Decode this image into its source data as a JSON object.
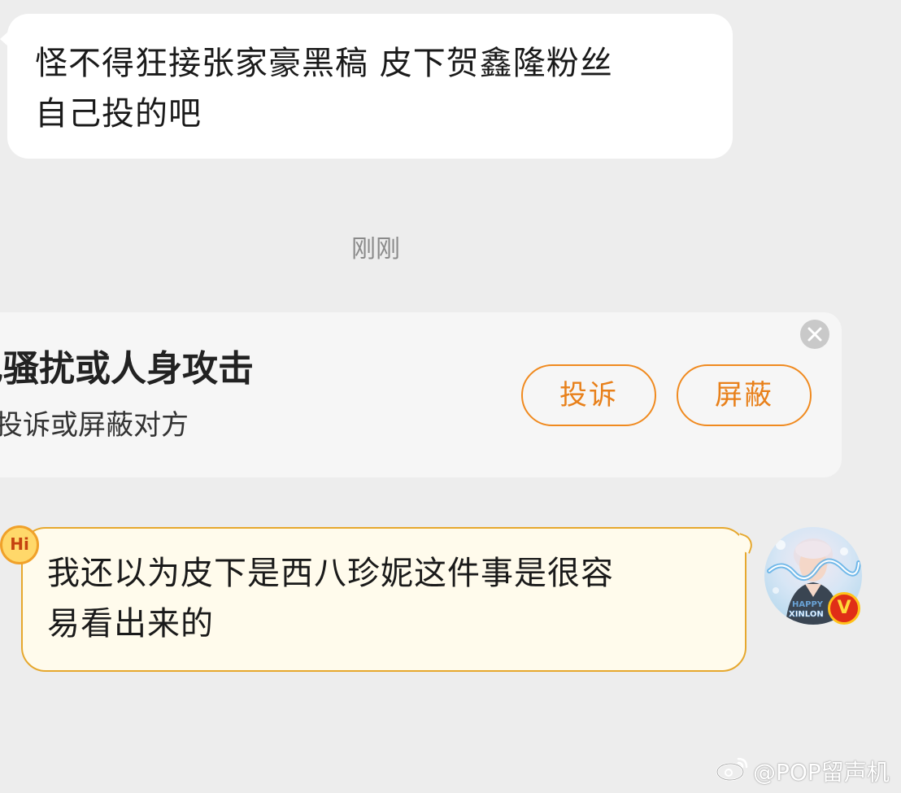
{
  "incoming_message": {
    "line1": "怪不得狂接张家豪黑稿 皮下贺鑫隆粉丝",
    "line2": "自己投的吧"
  },
  "timestamp": "刚刚",
  "warning": {
    "title": "也骚扰或人身攻击",
    "subtitle": "以投诉或屏蔽对方",
    "report_label": "投诉",
    "block_label": "屏蔽",
    "close_icon": "close-icon"
  },
  "outgoing_message": {
    "line1": "我还以为皮下是西八珍妮这件事是很容",
    "line2": "易看出来的",
    "badge_text": "Hi"
  },
  "avatar": {
    "banner_text": "HAPPY",
    "banner_text2": "XINLON",
    "verified_text": "V"
  },
  "watermark": {
    "text": "@POP留声机",
    "icon": "weibo-icon"
  },
  "colors": {
    "background": "#ededed",
    "accent_orange": "#f08a1f",
    "bubble_theme_border": "#e6a82e",
    "verified_red": "#e02e17"
  }
}
